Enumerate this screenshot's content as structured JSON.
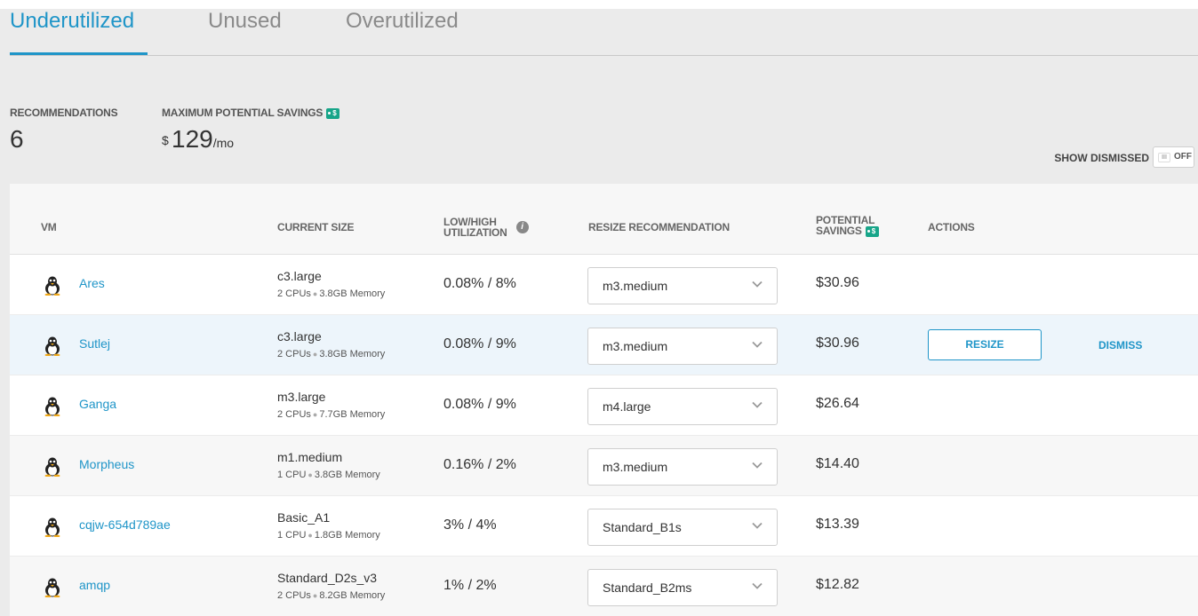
{
  "tabs": [
    {
      "label": "Underutilized",
      "active": true
    },
    {
      "label": "Unused",
      "active": false
    },
    {
      "label": "Overutilized",
      "active": false
    }
  ],
  "summary": {
    "recommendations_label": "RECOMMENDATIONS",
    "recommendations_value": "6",
    "savings_label": "MAXIMUM POTENTIAL SAVINGS",
    "savings_badge": "$",
    "savings_currency": "$",
    "savings_value": "129",
    "savings_period": "/mo"
  },
  "show_dismissed": {
    "label": "SHOW DISMISSED",
    "grip": "III",
    "state": "OFF"
  },
  "table": {
    "headers": {
      "vm": "VM",
      "current_size": "CURRENT SIZE",
      "utilization_line1": "LOW/HIGH",
      "utilization_line2": "UTILIZATION",
      "resize": "RESIZE RECOMMENDATION",
      "savings_line1": "POTENTIAL",
      "savings_line2": "SAVINGS",
      "savings_badge": "$",
      "actions": "ACTIONS"
    },
    "rows": [
      {
        "name": "Ares",
        "size": "c3.large",
        "cpus": "2 CPUs",
        "memory": "3.8GB Memory",
        "util": "0.08% / 8%",
        "recommendation": "m3.medium",
        "savings": "$30.96"
      },
      {
        "name": "Sutlej",
        "size": "c3.large",
        "cpus": "2 CPUs",
        "memory": "3.8GB Memory",
        "util": "0.08% / 9%",
        "recommendation": "m3.medium",
        "savings": "$30.96",
        "resize_label": "RESIZE",
        "dismiss_label": "DISMISS"
      },
      {
        "name": "Ganga",
        "size": "m3.large",
        "cpus": "2 CPUs",
        "memory": "7.7GB Memory",
        "util": "0.08% / 9%",
        "recommendation": "m4.large",
        "savings": "$26.64"
      },
      {
        "name": "Morpheus",
        "size": "m1.medium",
        "cpus": "1 CPU",
        "memory": "3.8GB Memory",
        "util": "0.16% / 2%",
        "recommendation": "m3.medium",
        "savings": "$14.40"
      },
      {
        "name": "cqjw-654d789ae",
        "size": "Basic_A1",
        "cpus": "1 CPU",
        "memory": "1.8GB Memory",
        "util": "3% / 4%",
        "recommendation": "Standard_B1s",
        "savings": "$13.39"
      },
      {
        "name": "amqp",
        "size": "Standard_D2s_v3",
        "cpus": "2 CPUs",
        "memory": "8.2GB Memory",
        "util": "1% / 2%",
        "recommendation": "Standard_B2ms",
        "savings": "$12.82"
      }
    ]
  },
  "colors": {
    "accent": "#1f95c8",
    "badge": "#17a589",
    "selected_row": "#edf5fb"
  },
  "icons": {
    "vm_os": "linux-penguin-icon",
    "dropdown": "chevron-down-icon",
    "info": "info-icon",
    "savings_tag": "dollar-tag-icon"
  }
}
